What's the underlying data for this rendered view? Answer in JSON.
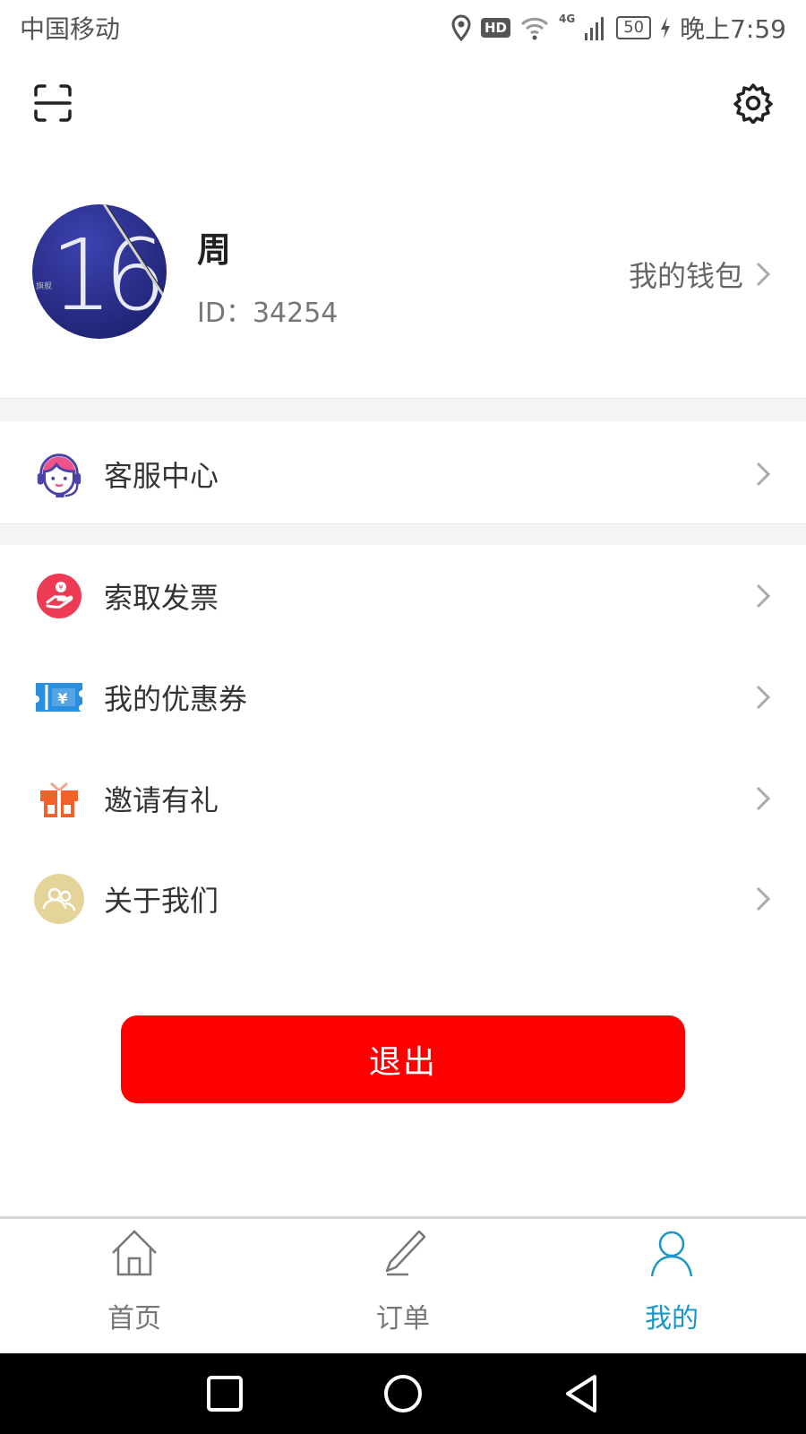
{
  "status_bar": {
    "carrier": "中国移动",
    "hd": "HD",
    "network": "4G",
    "battery": "50",
    "time": "晚上7:59"
  },
  "top_bar": {
    "scan_icon": "scan-icon",
    "settings_icon": "gear-icon"
  },
  "profile": {
    "avatar_text": "16",
    "avatar_tag": "旗舰",
    "name": "周",
    "id": "ID：34254",
    "wallet_label": "我的钱包"
  },
  "menu": {
    "service": {
      "label": "客服中心",
      "icon": "customer-service-icon"
    },
    "items": [
      {
        "label": "索取发票",
        "icon": "invoice-icon",
        "color": "#ee3a55"
      },
      {
        "label": "我的优惠券",
        "icon": "coupon-icon",
        "color": "#2b8fe0"
      },
      {
        "label": "邀请有礼",
        "icon": "gift-icon",
        "color": "#f0622a"
      },
      {
        "label": "关于我们",
        "icon": "about-us-icon",
        "color": "#e5d49a"
      }
    ]
  },
  "logout": {
    "label": "退出",
    "color": "#ff0000"
  },
  "tabs": [
    {
      "label": "首页",
      "icon": "home-icon",
      "active": false
    },
    {
      "label": "订单",
      "icon": "pencil-icon",
      "active": false
    },
    {
      "label": "我的",
      "icon": "user-icon",
      "active": true
    }
  ],
  "accent_color": "#1a97c8"
}
